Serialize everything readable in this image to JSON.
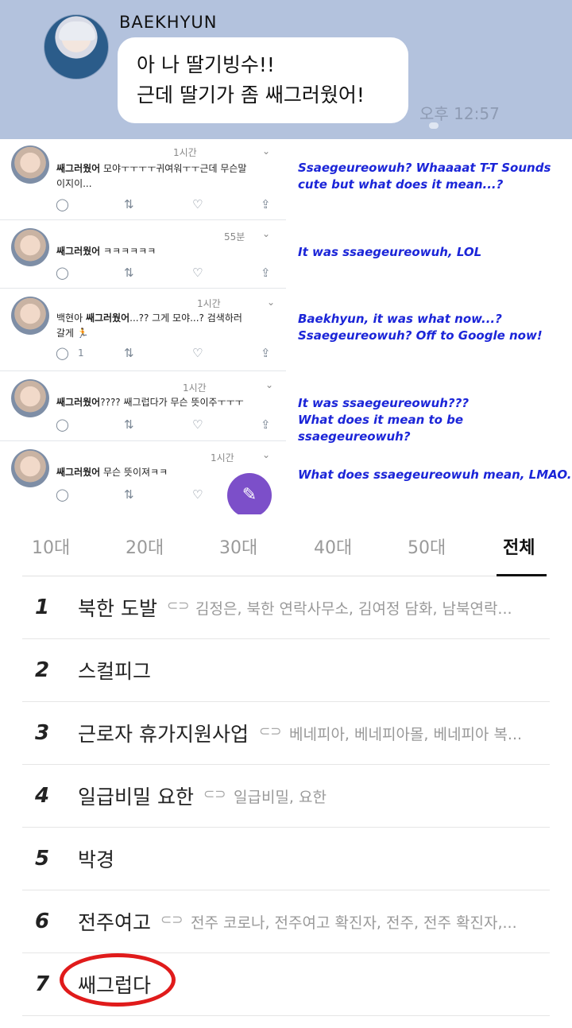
{
  "chat": {
    "sender": "BAEKHYUN",
    "message_line1": "아 나 딸기빙수!!",
    "message_line2": "근데 딸기가 좀 쌔그러웠어!",
    "time": "오후 12:57"
  },
  "tweets": [
    {
      "time": "1시간",
      "bold": "쌔그러웠어",
      "text_line1": " 모야ㅜㅜㅜㅜ귀여워ㅜㅜ근데 무슨말",
      "text_line2": "이지이...",
      "replies": "",
      "translation_line1": "Ssaegeureowuh? Whaaaat T-T Sounds",
      "translation_line2": "cute but what does it mean...?"
    },
    {
      "time": "55분",
      "bold": "쌔그러웠어",
      "text_line1": " ㅋㅋㅋㅋㅋㅋ",
      "text_line2": "",
      "replies": "",
      "translation_line1": "It was ssaegeureowuh, LOL",
      "translation_line2": ""
    },
    {
      "time": "1시간",
      "pre": "백현아 ",
      "bold": "쌔그러웠어",
      "text_line1": "...?? 그게 모야...? 검색하러",
      "text_line2": "갈게 🏃",
      "replies": "1",
      "translation_line1": "Baekhyun, it was what now...?",
      "translation_line2": "Ssaegeureowuh? Off to Google now!"
    },
    {
      "time": "1시간",
      "bold": "쌔그러웠어",
      "text_line1": "???? 쌔그럽다가 무슨 뜻이주ㅜㅜㅜ",
      "text_line2": "",
      "replies": "",
      "translation_line1": "It was ssaegeureowuh???",
      "translation_line2": "What does it mean to be ssaegeureowuh?"
    },
    {
      "time": "1시간",
      "bold": "쌔그러웠어",
      "text_line1": " 무슨 뜻이져ㅋㅋ",
      "text_line2": "",
      "replies": "",
      "translation_line1": "What does ssaegeureowuh mean, LMAO.",
      "translation_line2": ""
    }
  ],
  "age_tabs": [
    "10대",
    "20대",
    "30대",
    "40대",
    "50대",
    "전체"
  ],
  "active_tab": "전체",
  "ranking": [
    {
      "rank": "1",
      "title": "북한 도발",
      "related": "김정은, 북한 연락사무소, 김여정 담화, 남북연락..."
    },
    {
      "rank": "2",
      "title": "스컬피그",
      "related": ""
    },
    {
      "rank": "3",
      "title": "근로자 휴가지원사업",
      "related": "베네피아, 베네피아몰, 베네피아 복..."
    },
    {
      "rank": "4",
      "title": "일급비밀 요한",
      "related": "일급비밀, 요한"
    },
    {
      "rank": "5",
      "title": "박경",
      "related": ""
    },
    {
      "rank": "6",
      "title": "전주여고",
      "related": "전주 코로나, 전주여고 확진자, 전주, 전주 확진자,..."
    },
    {
      "rank": "7",
      "title": "쌔그럽다",
      "related": ""
    }
  ],
  "highlight_color": "#e01b1b",
  "translation_color": "#1b25d8"
}
